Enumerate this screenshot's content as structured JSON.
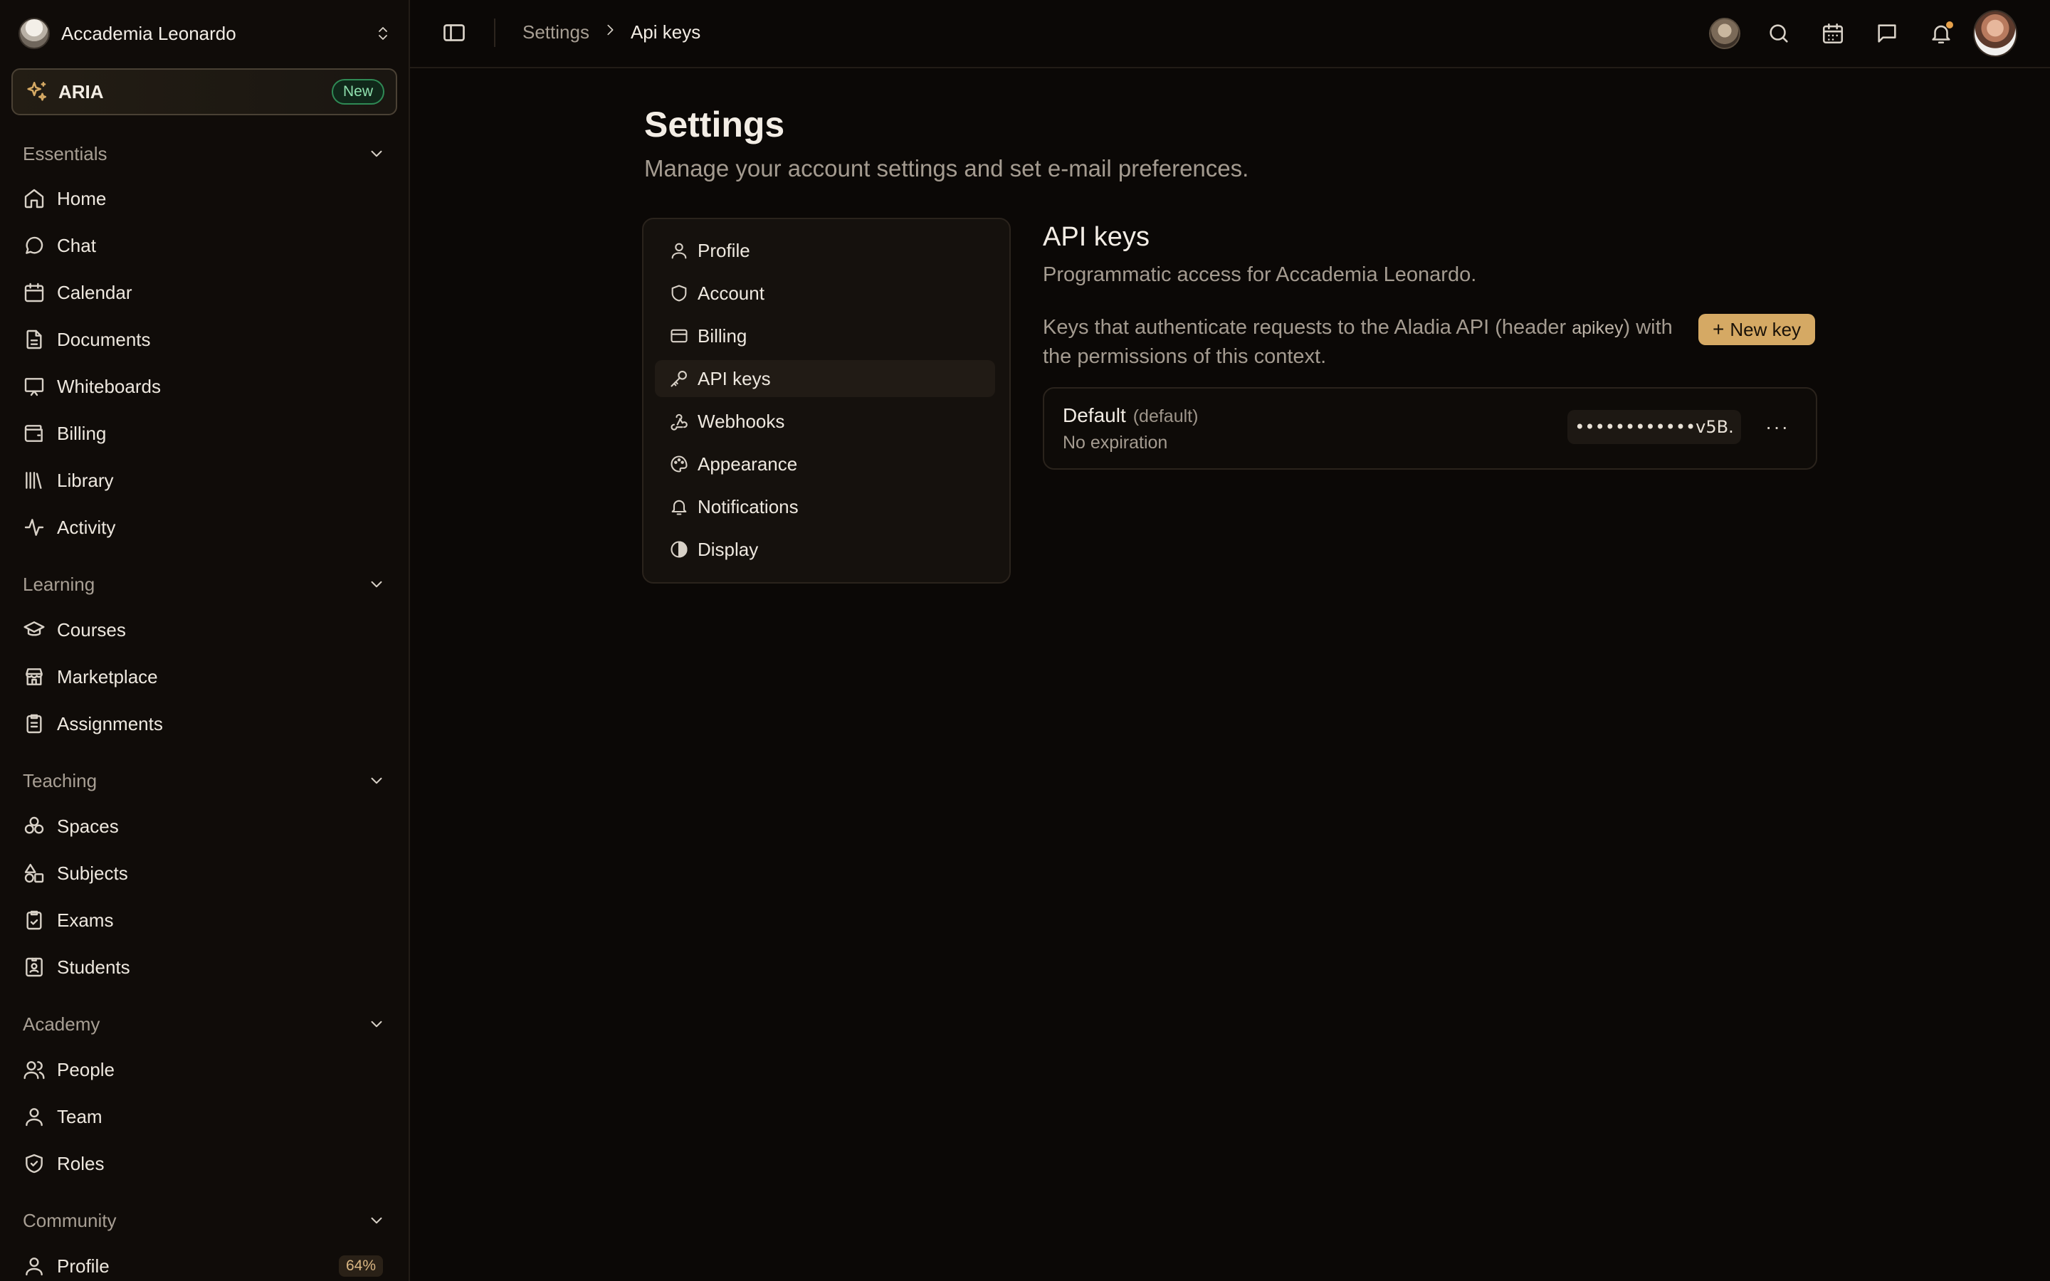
{
  "workspace": {
    "name": "Accademia Leonardo"
  },
  "aria": {
    "label": "ARIA",
    "badge": "New"
  },
  "sidebar": {
    "sections": [
      {
        "title": "Essentials",
        "items": [
          {
            "label": "Home",
            "icon": "home-icon"
          },
          {
            "label": "Chat",
            "icon": "chat-icon"
          },
          {
            "label": "Calendar",
            "icon": "calendar-icon"
          },
          {
            "label": "Documents",
            "icon": "document-icon"
          },
          {
            "label": "Whiteboards",
            "icon": "whiteboard-icon"
          },
          {
            "label": "Billing",
            "icon": "wallet-icon"
          },
          {
            "label": "Library",
            "icon": "library-icon"
          },
          {
            "label": "Activity",
            "icon": "activity-icon"
          }
        ]
      },
      {
        "title": "Learning",
        "items": [
          {
            "label": "Courses",
            "icon": "graduation-cap-icon"
          },
          {
            "label": "Marketplace",
            "icon": "store-icon"
          },
          {
            "label": "Assignments",
            "icon": "clipboard-icon"
          }
        ]
      },
      {
        "title": "Teaching",
        "items": [
          {
            "label": "Spaces",
            "icon": "spaces-icon"
          },
          {
            "label": "Subjects",
            "icon": "shapes-icon"
          },
          {
            "label": "Exams",
            "icon": "clipboard-check-icon"
          },
          {
            "label": "Students",
            "icon": "id-badge-icon"
          }
        ]
      },
      {
        "title": "Academy",
        "items": [
          {
            "label": "People",
            "icon": "users-icon"
          },
          {
            "label": "Team",
            "icon": "user-icon"
          },
          {
            "label": "Roles",
            "icon": "shield-check-icon"
          }
        ]
      },
      {
        "title": "Community",
        "items": [
          {
            "label": "Profile",
            "icon": "user-icon",
            "badge": "64%"
          }
        ]
      }
    ]
  },
  "breadcrumb": {
    "parent": "Settings",
    "current": "Api keys"
  },
  "page": {
    "title": "Settings",
    "subtitle": "Manage your account settings and set e-mail preferences."
  },
  "settings_nav": {
    "active": "API keys",
    "items": [
      {
        "label": "Profile",
        "icon": "user-icon"
      },
      {
        "label": "Account",
        "icon": "shield-icon"
      },
      {
        "label": "Billing",
        "icon": "credit-card-icon"
      },
      {
        "label": "API keys",
        "icon": "key-icon"
      },
      {
        "label": "Webhooks",
        "icon": "webhook-icon"
      },
      {
        "label": "Appearance",
        "icon": "palette-icon"
      },
      {
        "label": "Notifications",
        "icon": "bell-icon"
      },
      {
        "label": "Display",
        "icon": "contrast-icon"
      }
    ]
  },
  "api_keys": {
    "title": "API keys",
    "subtitle": "Programmatic access for Accademia Leonardo.",
    "desc_before": "Keys that authenticate requests to the Aladia API (header ",
    "desc_code": "apikey",
    "desc_after": ") with the permissions of this context.",
    "new_key_label": "New key",
    "keys": [
      {
        "name": "Default",
        "tag": "(default)",
        "expiry": "No expiration",
        "masked": "••••••••••••v5B.",
        "menu": "···"
      }
    ]
  },
  "colors": {
    "accent": "#d5a964",
    "background": "#0b0806",
    "new_badge": "#8fe0ae"
  }
}
